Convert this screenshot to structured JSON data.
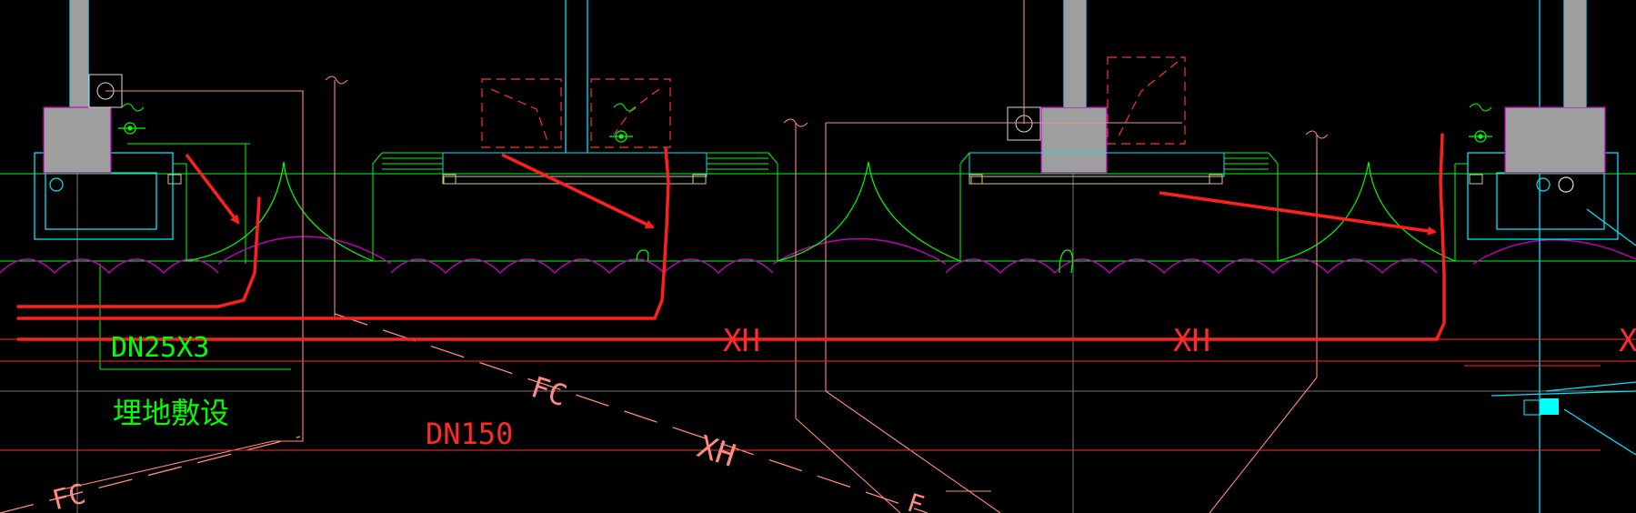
{
  "colors": {
    "background": "#000000",
    "wall": "#00e5ff",
    "column_fill": "#9e9e9e",
    "column_edge": "#c400c4",
    "door": "#00ff00",
    "pipe_hydrant": "#ff2b2b",
    "pipe_thin": "#ff6a6a",
    "dashed_equipment": "#ff3030",
    "leader": "#ff8a80",
    "soil_arc": "#c000c0",
    "grid": "#d9d9d9",
    "annotation_arrow": "#ff1f1f",
    "cyan_solid": "#00ffff"
  },
  "labels": {
    "dn25_label": "DN25X3",
    "buried_label": "埋地敷设",
    "dn150_label": "DN150",
    "xh_label_1": "XH",
    "xh_label_2": "XH",
    "xh_label_3": "XH",
    "xh_label_edge": "X",
    "fc_label_1": "FC",
    "fc_label_2": "FC",
    "fc_label_3": "F"
  },
  "icons": {
    "valve_marker": "valve-icon",
    "hydrant_box": "hydrant-box-icon",
    "break_symbol": "break-line-icon",
    "annotation_arrow": "arrow-icon"
  }
}
